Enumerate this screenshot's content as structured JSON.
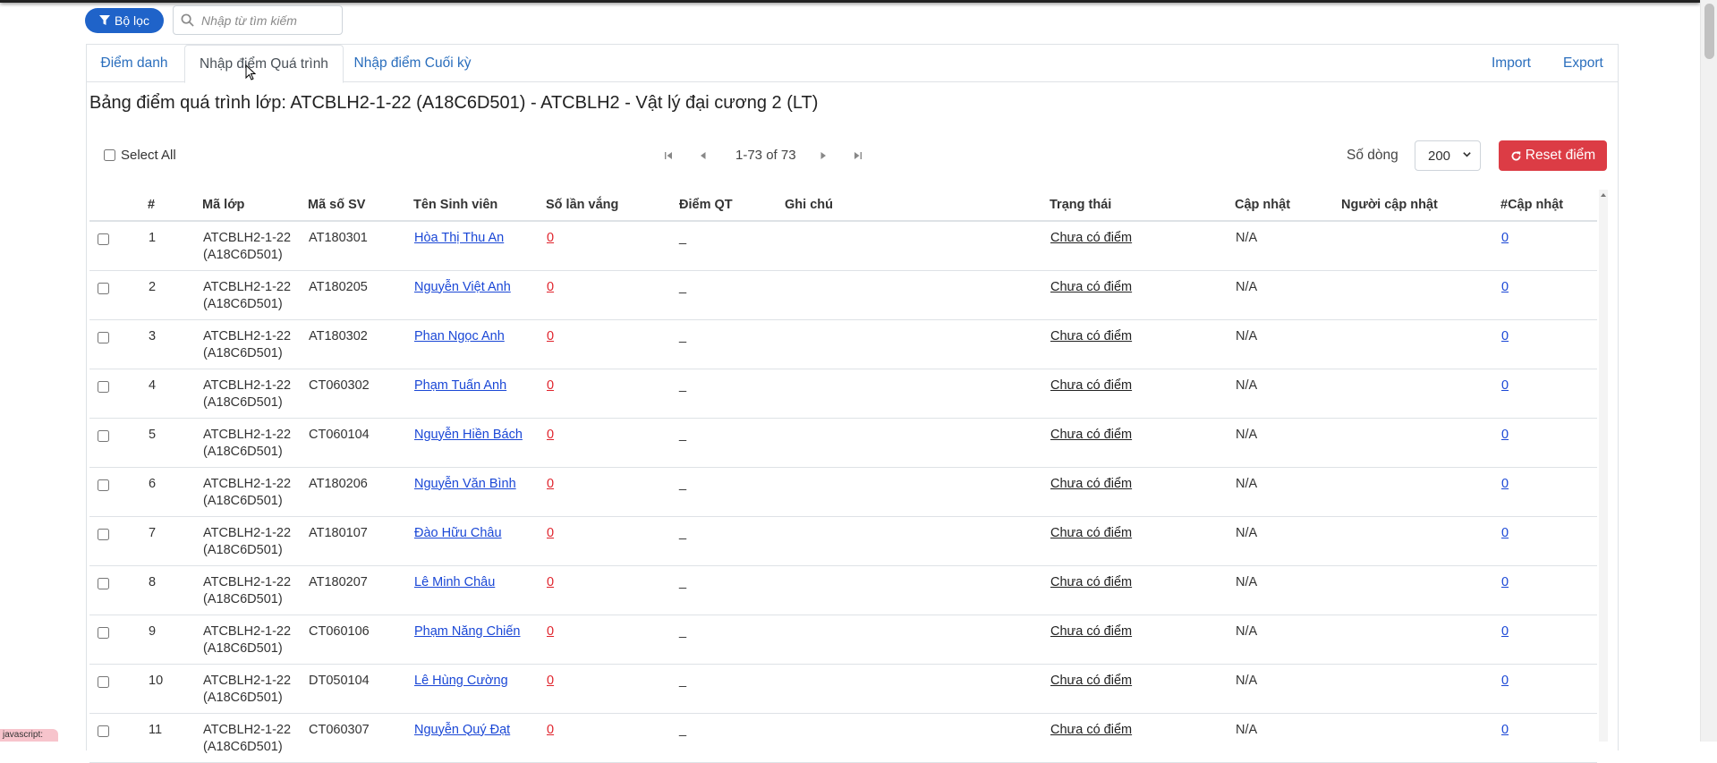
{
  "toolbar": {
    "filter_label": "Bộ lọc",
    "search_placeholder": "Nhập từ tìm kiếm"
  },
  "tabs": [
    {
      "label": "Điểm danh",
      "active": false
    },
    {
      "label": "Nhập điểm Quá trình",
      "active": true
    },
    {
      "label": "Nhập điểm Cuối kỳ",
      "active": false
    }
  ],
  "tab_actions": {
    "import": "Import",
    "export": "Export"
  },
  "title": "Bảng điểm quá trình lớp: ATCBLH2-1-22 (A18C6D501) - ATCBLH2 - Vật lý đại cương 2 (LT)",
  "controls": {
    "select_all": "Select All",
    "pagination": "1-73 of 73",
    "rows_label": "Số dòng",
    "rows_value": "200",
    "reset_label": "Reset điểm"
  },
  "table": {
    "headers": [
      "#",
      "Mã lớp",
      "Mã số SV",
      "Tên Sinh viên",
      "Số lần vắng",
      "Điểm QT",
      "Ghi chú",
      "Trạng thái",
      "Cập nhật",
      "Người cập nhật",
      "#Cập nhật"
    ],
    "rows": [
      {
        "no": "1",
        "class_a": "ATCBLH2-1-22",
        "class_b": "(A18C6D501)",
        "student_id": "AT180301",
        "name": "Hòa Thị Thu An",
        "absent": "0",
        "score": "_",
        "note": "",
        "status": "Chưa có điểm",
        "updated": "N/A",
        "updater": "",
        "update_count": "0"
      },
      {
        "no": "2",
        "class_a": "ATCBLH2-1-22",
        "class_b": "(A18C6D501)",
        "student_id": "AT180205",
        "name": "Nguyễn Việt Anh",
        "absent": "0",
        "score": "_",
        "note": "",
        "status": "Chưa có điểm",
        "updated": "N/A",
        "updater": "",
        "update_count": "0"
      },
      {
        "no": "3",
        "class_a": "ATCBLH2-1-22",
        "class_b": "(A18C6D501)",
        "student_id": "AT180302",
        "name": "Phan Ngọc Anh",
        "absent": "0",
        "score": "_",
        "note": "",
        "status": "Chưa có điểm",
        "updated": "N/A",
        "updater": "",
        "update_count": "0"
      },
      {
        "no": "4",
        "class_a": "ATCBLH2-1-22",
        "class_b": "(A18C6D501)",
        "student_id": "CT060302",
        "name": "Phạm Tuấn Anh",
        "absent": "0",
        "score": "_",
        "note": "",
        "status": "Chưa có điểm",
        "updated": "N/A",
        "updater": "",
        "update_count": "0"
      },
      {
        "no": "5",
        "class_a": "ATCBLH2-1-22",
        "class_b": "(A18C6D501)",
        "student_id": "CT060104",
        "name": "Nguyễn Hiền Bách",
        "absent": "0",
        "score": "_",
        "note": "",
        "status": "Chưa có điểm",
        "updated": "N/A",
        "updater": "",
        "update_count": "0"
      },
      {
        "no": "6",
        "class_a": "ATCBLH2-1-22",
        "class_b": "(A18C6D501)",
        "student_id": "AT180206",
        "name": "Nguyễn Văn Bình",
        "absent": "0",
        "score": "_",
        "note": "",
        "status": "Chưa có điểm",
        "updated": "N/A",
        "updater": "",
        "update_count": "0"
      },
      {
        "no": "7",
        "class_a": "ATCBLH2-1-22",
        "class_b": "(A18C6D501)",
        "student_id": "AT180107",
        "name": "Đào Hữu Châu",
        "absent": "0",
        "score": "_",
        "note": "",
        "status": "Chưa có điểm",
        "updated": "N/A",
        "updater": "",
        "update_count": "0"
      },
      {
        "no": "8",
        "class_a": "ATCBLH2-1-22",
        "class_b": "(A18C6D501)",
        "student_id": "AT180207",
        "name": "Lê Minh Châu",
        "absent": "0",
        "score": "_",
        "note": "",
        "status": "Chưa có điểm",
        "updated": "N/A",
        "updater": "",
        "update_count": "0"
      },
      {
        "no": "9",
        "class_a": "ATCBLH2-1-22",
        "class_b": "(A18C6D501)",
        "student_id": "CT060106",
        "name": "Phạm Năng Chiến",
        "absent": "0",
        "score": "_",
        "note": "",
        "status": "Chưa có điểm",
        "updated": "N/A",
        "updater": "",
        "update_count": "0"
      },
      {
        "no": "10",
        "class_a": "ATCBLH2-1-22",
        "class_b": "(A18C6D501)",
        "student_id": "DT050104",
        "name": "Lê Hùng Cường",
        "absent": "0",
        "score": "_",
        "note": "",
        "status": "Chưa có điểm",
        "updated": "N/A",
        "updater": "",
        "update_count": "0"
      },
      {
        "no": "11",
        "class_a": "ATCBLH2-1-22",
        "class_b": "(A18C6D501)",
        "student_id": "CT060307",
        "name": "Nguyễn Quý Đạt",
        "absent": "0",
        "score": "_",
        "note": "",
        "status": "Chưa có điểm",
        "updated": "N/A",
        "updater": "",
        "update_count": "0"
      }
    ]
  },
  "status_bar": "javascript:",
  "icons": {
    "filter": "filter-icon",
    "search": "search-icon",
    "refresh": "refresh-icon",
    "first_page": "first-page-icon",
    "prev_page": "prev-page-icon",
    "next_page": "next-page-icon",
    "last_page": "last-page-icon"
  },
  "colors": {
    "primary": "#1f63c9",
    "danger": "#dc3c45",
    "link": "#1a47d6",
    "absent_link": "#e0242d"
  }
}
